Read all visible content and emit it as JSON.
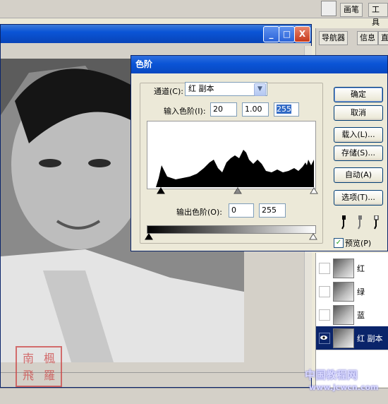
{
  "top_strip": {
    "tabs": [
      "画笔",
      "工具"
    ]
  },
  "document_window": {
    "buttons": [
      "_",
      "□",
      "X"
    ]
  },
  "navigator_panel": {
    "tabs": [
      "导航器",
      "信息",
      "直"
    ]
  },
  "layers": [
    {
      "name": "红",
      "selected": false
    },
    {
      "name": "绿",
      "selected": false
    },
    {
      "name": "蓝",
      "selected": false
    },
    {
      "name": "红 副本",
      "selected": true
    }
  ],
  "levels_dialog": {
    "title": "色阶",
    "channel_label": "通道(C):",
    "channel_value": "红 副本",
    "input_levels_label": "输入色阶(I):",
    "input_levels": [
      "20",
      "1.00",
      "255"
    ],
    "output_levels_label": "输出色阶(O):",
    "output_levels": [
      "0",
      "255"
    ],
    "buttons": {
      "ok": "确定",
      "cancel": "取消",
      "load": "载入(L)...",
      "save": "存储(S)...",
      "auto": "自动(A)",
      "options": "选项(T)..."
    },
    "preview_label": "预览(P)",
    "preview_checked": true
  },
  "watermark": {
    "text": "中国教程网",
    "url": "www.jcwcn.com"
  },
  "seal": {
    "text": [
      "南",
      "楓",
      "飛",
      "羅"
    ]
  },
  "colors": {
    "titlebar": "#0a54d6",
    "selection": "#316ac5"
  }
}
